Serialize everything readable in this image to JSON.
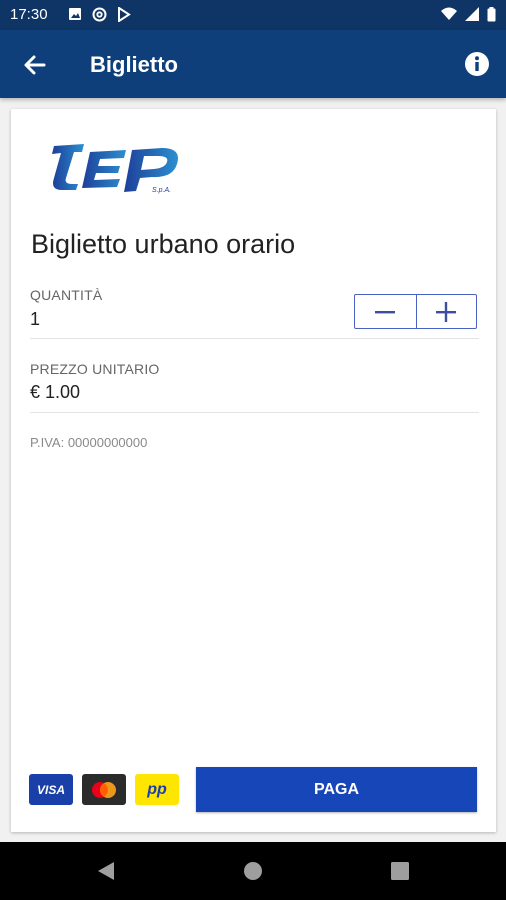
{
  "status_bar": {
    "time": "17:30",
    "left_icons": [
      "image-notification-icon",
      "at-notification-icon",
      "play-store-icon"
    ],
    "right_icons": [
      "wifi-icon",
      "signal-icon",
      "battery-icon"
    ]
  },
  "app_bar": {
    "title": "Biglietto",
    "back_icon": "arrow-left-icon",
    "info_icon": "info-icon"
  },
  "ticket": {
    "operator_logo": "TEP S.p.A.",
    "name": "Biglietto urbano orario",
    "quantity_label": "QUANTITÀ",
    "quantity_value": "1",
    "unit_price_label": "PREZZO UNITARIO",
    "unit_price_value": "€ 1.00",
    "vat_number": "P.IVA: 00000000000"
  },
  "payment": {
    "methods": [
      "VISA",
      "Mastercard",
      "pp"
    ],
    "pay_button_label": "PAGA"
  },
  "colors": {
    "status_bar": "#0f3566",
    "app_bar": "#0f3f7a",
    "accent": "#1746b8",
    "stepper_border": "#4a63c2"
  },
  "nav_bar": {
    "icons": [
      "back-triangle-icon",
      "home-circle-icon",
      "recents-square-icon"
    ]
  }
}
